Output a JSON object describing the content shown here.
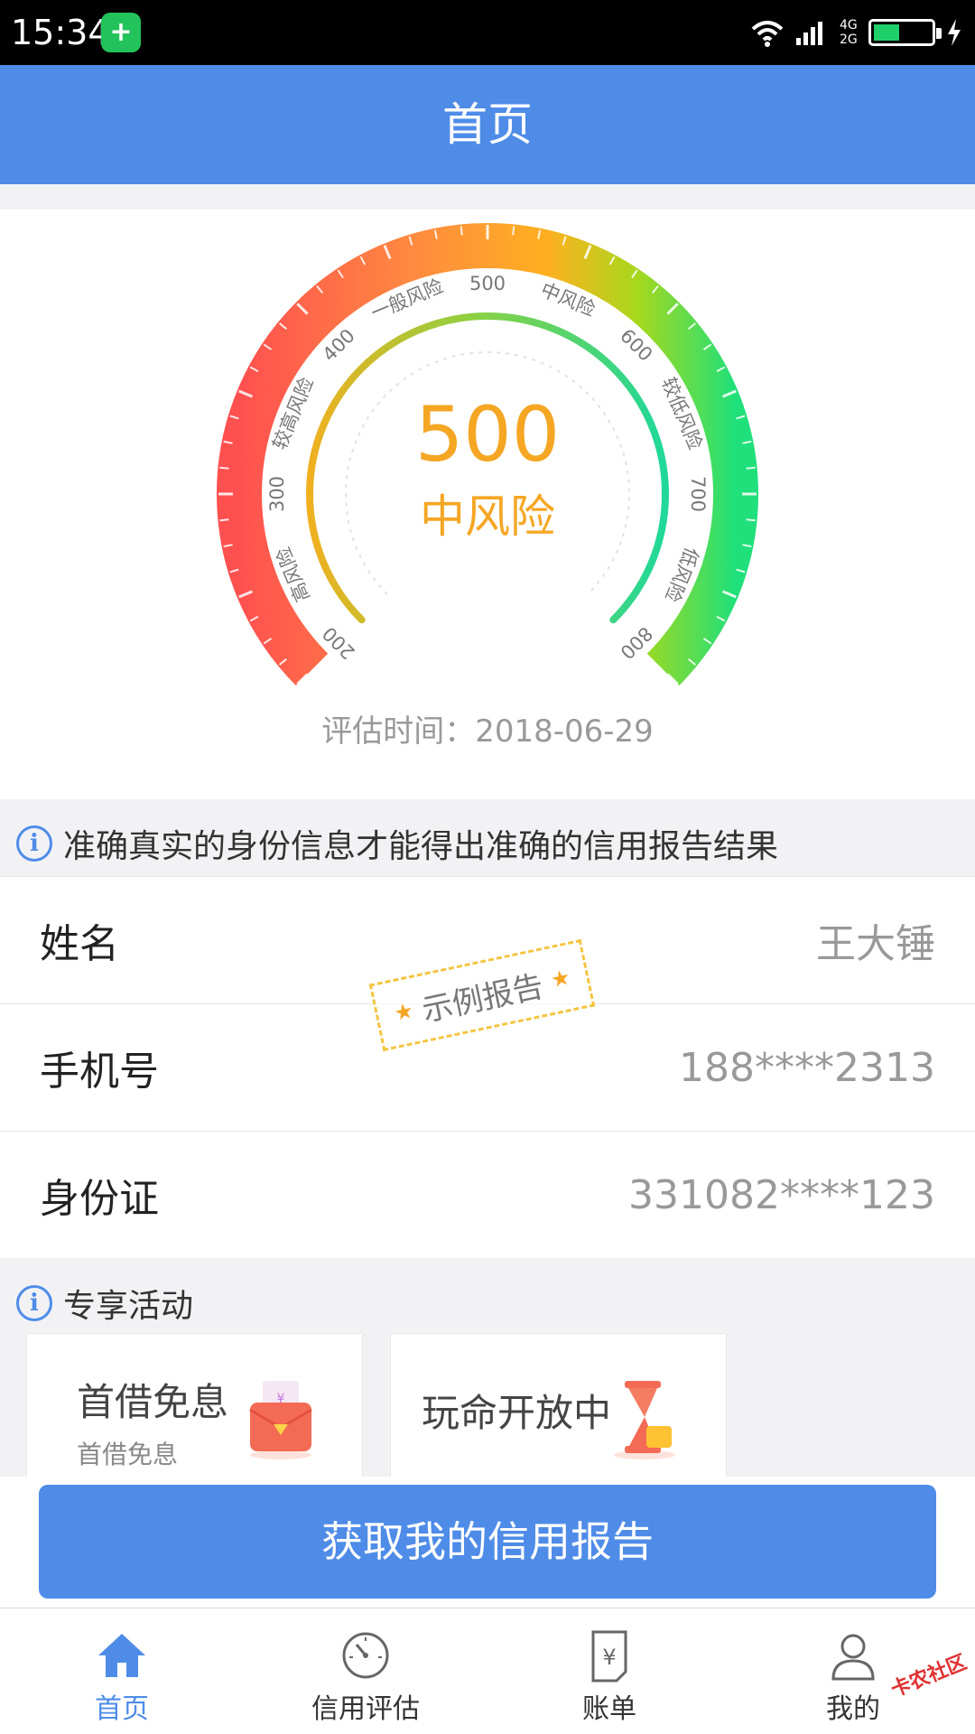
{
  "status_bar": {
    "time": "15:34",
    "network_top": "4G",
    "network_bottom": "2G",
    "battery_percent": 45
  },
  "header": {
    "title": "首页"
  },
  "gauge": {
    "score": "500",
    "level": "中风险",
    "scale_labels": [
      "200",
      "高风险",
      "300",
      "较高风险",
      "400",
      "一般风险",
      "500",
      "中风险",
      "600",
      "较低风险",
      "700",
      "低风险",
      "800"
    ],
    "eval_time": "评估时间：2018-06-29",
    "colors": {
      "low_end": "#ff5555",
      "mid": "#ffb020",
      "high_end": "#22dd77",
      "score_text": "#f5a623"
    }
  },
  "notice": {
    "text": "准确真实的身份信息才能得出准确的信用报告结果"
  },
  "profile": {
    "rows": [
      {
        "label": "姓名",
        "value": "王大锤"
      },
      {
        "label": "手机号",
        "value": "188****2313"
      },
      {
        "label": "身份证",
        "value": "331082****123"
      }
    ],
    "stamp": "示例报告"
  },
  "activities": {
    "title": "专享活动",
    "cards": [
      {
        "title": "首借免息",
        "subtitle": "首借免息",
        "icon": "red-envelope-icon"
      },
      {
        "title": "玩命开放中",
        "subtitle": "",
        "icon": "hourglass-icon"
      }
    ]
  },
  "cta": {
    "label": "获取我的信用报告"
  },
  "tabs": [
    {
      "label": "首页",
      "icon": "home-icon",
      "active": true
    },
    {
      "label": "信用评估",
      "icon": "gauge-icon",
      "active": false
    },
    {
      "label": "账单",
      "icon": "bill-icon",
      "active": false
    },
    {
      "label": "我的",
      "icon": "user-icon",
      "active": false
    }
  ],
  "watermark": "卡农社区",
  "theme": {
    "primary": "#4f8ce8"
  }
}
